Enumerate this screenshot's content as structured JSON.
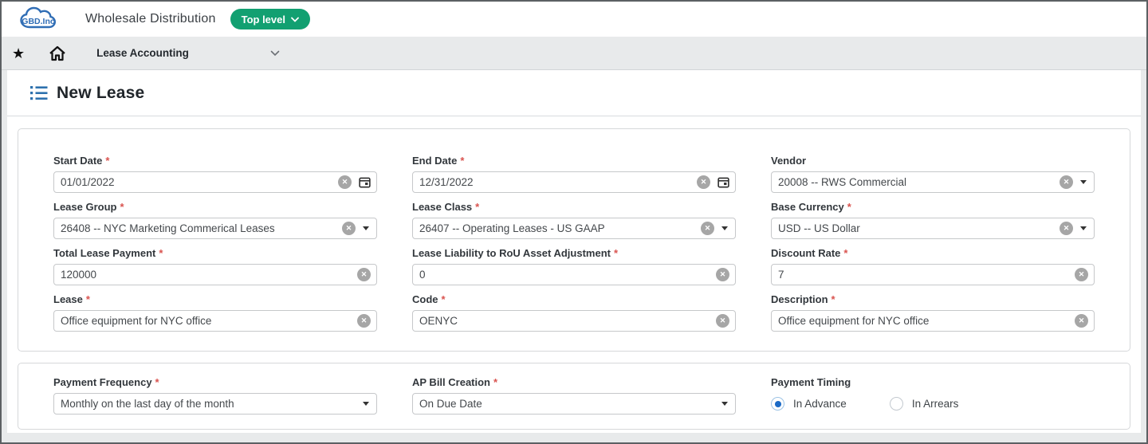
{
  "colors": {
    "accent_green": "#12a071",
    "brand_blue": "#2f6db5",
    "required_red": "#d9534f",
    "radio_blue": "#1b6ac6",
    "nav_bar_gray": "#e8eaeb"
  },
  "required_marker": "*",
  "header": {
    "logo_text": "GBD.Inc",
    "app_title": "Wholesale Distribution",
    "entity_button_label": "Top level"
  },
  "nav": {
    "module": "Lease Accounting"
  },
  "page": {
    "title": "New Lease"
  },
  "form": {
    "start_date": {
      "label": "Start Date",
      "value": "01/01/2022"
    },
    "end_date": {
      "label": "End Date",
      "value": "12/31/2022"
    },
    "vendor": {
      "label": "Vendor",
      "value": "20008 -- RWS Commercial"
    },
    "lease_group": {
      "label": "Lease Group",
      "value": "26408 -- NYC Marketing Commerical Leases"
    },
    "lease_class": {
      "label": "Lease Class",
      "value": "26407 -- Operating Leases - US GAAP"
    },
    "base_currency": {
      "label": "Base Currency",
      "value": "USD -- US Dollar"
    },
    "total_lease_payment": {
      "label": "Total Lease Payment",
      "value": "120000"
    },
    "lease_liability_rou": {
      "label": "Lease Liability to RoU Asset Adjustment",
      "value": "0"
    },
    "discount_rate": {
      "label": "Discount Rate",
      "value": "7"
    },
    "lease": {
      "label": "Lease",
      "value": "Office equipment for NYC office"
    },
    "code": {
      "label": "Code",
      "value": "OENYC"
    },
    "description": {
      "label": "Description",
      "value": "Office equipment for NYC office"
    },
    "payment_frequency": {
      "label": "Payment Frequency",
      "value": "Monthly on the last day of the month"
    },
    "ap_bill_creation": {
      "label": "AP Bill Creation",
      "value": "On Due Date"
    },
    "payment_timing": {
      "label": "Payment Timing",
      "options": [
        {
          "label": "In Advance",
          "selected": true
        },
        {
          "label": "In Arrears",
          "selected": false
        }
      ]
    }
  }
}
